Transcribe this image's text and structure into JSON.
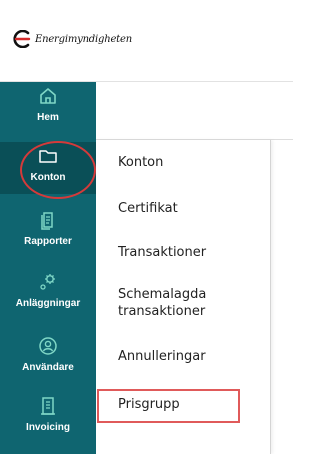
{
  "brand": {
    "name": "Energimyndigheten"
  },
  "sidebar": {
    "items": [
      {
        "label": "Hem",
        "icon": "home-icon"
      },
      {
        "label": "Konton",
        "icon": "folder-icon"
      },
      {
        "label": "Rapporter",
        "icon": "document-icon"
      },
      {
        "label": "Anläggningar",
        "icon": "gears-icon"
      },
      {
        "label": "Användare",
        "icon": "user-icon"
      },
      {
        "label": "Invoicing",
        "icon": "invoice-icon"
      }
    ],
    "active": "Konton"
  },
  "submenu": {
    "items": [
      {
        "label": "Konton"
      },
      {
        "label": "Certifikat"
      },
      {
        "label": "Transaktioner"
      },
      {
        "label": "Schemalagda transaktioner"
      },
      {
        "label": "Annulleringar"
      },
      {
        "label": "Prisgrupp"
      }
    ],
    "highlighted": "Prisgrupp"
  },
  "colors": {
    "sidebar": "#0f6570",
    "sidebar_active": "#0a4f57",
    "annotation": "#d53a3a",
    "icon_stroke": "#7fd7c6"
  }
}
